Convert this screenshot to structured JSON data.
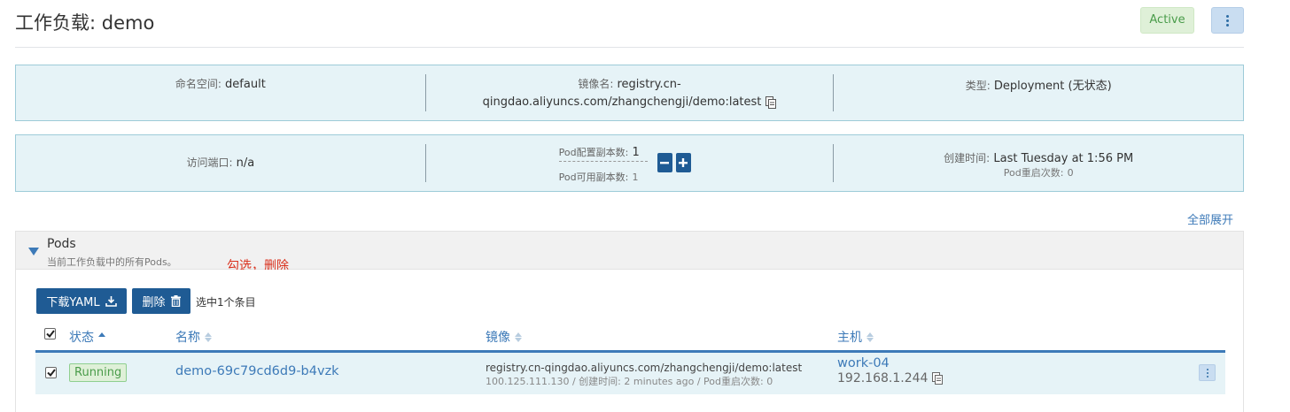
{
  "header": {
    "title": "工作负载: demo",
    "status": "Active"
  },
  "info_row1": {
    "namespace_label": "命名空间:",
    "namespace_value": "default",
    "image_label": "镜像名:",
    "image_value_line1": "registry.cn-",
    "image_value_line2": "qingdao.aliyuncs.com/zhangchengji/demo:latest",
    "type_label": "类型:",
    "type_value": "Deployment (无状态)"
  },
  "info_row2": {
    "port_label": "访问端口:",
    "port_value": "n/a",
    "replicas_config_label": "Pod配置副本数:",
    "replicas_config_value": "1",
    "replicas_available_label": "Pod可用副本数:",
    "replicas_available_value": "1",
    "created_label": "创建时间:",
    "created_value": "Last Tuesday at 1:56 PM",
    "restarts_label": "Pod重启次数:",
    "restarts_value": "0"
  },
  "expand_all": "全部展开",
  "pods": {
    "title": "Pods",
    "subtitle": "当前工作负载中的所有Pods。",
    "annotation": "勾选，删除",
    "download_yaml": "下载YAML",
    "delete": "删除",
    "selected_text": "选中1个条目",
    "columns": {
      "status": "状态",
      "name": "名称",
      "image": "镜像",
      "host": "主机"
    },
    "rows": [
      {
        "checked": true,
        "status": "Running",
        "name": "demo-69c79cd6d9-b4vzk",
        "image": "registry.cn-qingdao.aliyuncs.com/zhangchengji/demo:latest",
        "meta": "100.125.111.130 / 创建时间: 2 minutes ago / Pod重启次数: 0",
        "host_name": "work-04",
        "host_ip": "192.168.1.244"
      }
    ]
  },
  "colors": {
    "accent": "#3d7ab8",
    "button": "#1f5b94",
    "info_bg": "#e6f3f7",
    "running": "#4a9c4a",
    "annotation": "#d9301c"
  },
  "icons": [
    "download-icon",
    "trash-icon",
    "copy-icon",
    "more-vertical-icon",
    "minus-icon",
    "plus-icon",
    "caret-down-icon",
    "sort-icon",
    "checkbox-checked-icon"
  ]
}
